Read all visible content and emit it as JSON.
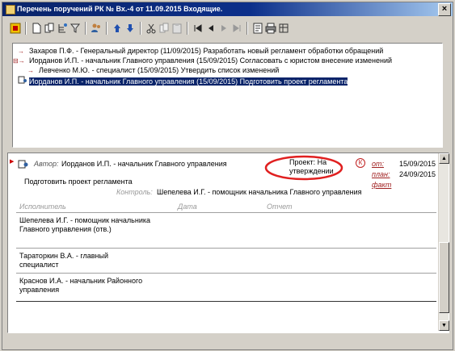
{
  "window": {
    "title": "Перечень поручений РК № Вх.-4 от 11.09.2015 Входящие.",
    "close_label": "×"
  },
  "toolbar": {
    "icons": [
      "refresh-icon",
      "new-doc-icon",
      "copy-icon",
      "tree-icon",
      "users-icon",
      "up-icon",
      "down-icon",
      "cut-icon",
      "copy2-icon",
      "paste-icon",
      "first-icon",
      "prev-icon",
      "next-icon",
      "last-icon",
      "report-icon",
      "print-icon",
      "options-icon"
    ]
  },
  "tree": {
    "rows": [
      {
        "text": "Захаров П.Ф. - Генеральный директор (11/09/2015) Разработать новый регламент обработки обращений",
        "level": 0,
        "prefix": "→"
      },
      {
        "text": "Иорданов И.П. - начальник Главного управления (15/09/2015) Согласовать с юристом внесение изменений",
        "level": 0,
        "prefix": "⊟→"
      },
      {
        "text": "Левченко М.Ю. - специалист (15/09/2015) Утвердить список изменений",
        "level": 1,
        "prefix": "→"
      },
      {
        "text": "Иорданов И.П. - начальник Главного управления (15/09/2015) Подготовить проект регламента",
        "level": 0,
        "prefix": "",
        "selected": true
      }
    ]
  },
  "detail": {
    "author_label": "Автор:",
    "author_value": "Иорданов И.П. - начальник Главного управления",
    "status": "Проект: На утверждении",
    "status_mark": "К",
    "from_label": "от:",
    "from_date": "15/09/2015",
    "plan_label": "план:",
    "plan_date": "24/09/2015",
    "fact_label": "факт",
    "task_text": "Подготовить проект регламента",
    "control_label": "Контроль:",
    "control_value": "Шепелева И.Г. - помощник начальника Главного управления",
    "table": {
      "headers": [
        "Исполнитель",
        "Дата",
        "Отчет"
      ],
      "rows": [
        {
          "executor": "Шепелева И.Г. - помощник начальника Главного управления (отв.)"
        },
        {
          "executor": "Тараторкин В.А. - главный специалист"
        },
        {
          "executor": "Краснов И.А. - начальник Районного управления"
        }
      ]
    }
  },
  "colors": {
    "title_bar": "#0a246a",
    "highlight_circle": "#e02020",
    "selection": "#0a246a"
  }
}
